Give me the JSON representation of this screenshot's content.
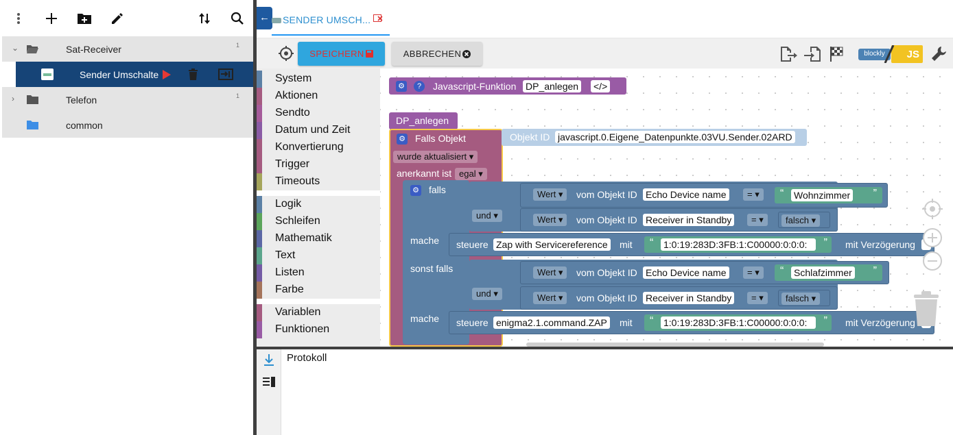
{
  "sidebar": {
    "toolbar": {
      "menu_icon": "more-vert-icon",
      "add_icon": "add-icon",
      "add_folder_icon": "create-folder-icon",
      "edit_icon": "edit-icon",
      "sort_icon": "sort-icon",
      "search_icon": "search-icon"
    },
    "tree": [
      {
        "label": "Sat-Receiver",
        "count": "1",
        "expanded": true
      },
      {
        "label": "Sender Umschalte",
        "selected": true
      },
      {
        "label": "Telefon",
        "count": "1",
        "expanded": false
      },
      {
        "label": "common"
      }
    ]
  },
  "tabs": [
    {
      "label": "SENDER UMSCH..."
    }
  ],
  "toolbar": {
    "save_label": "SPEICHERN",
    "cancel_label": "ABBRECHEN"
  },
  "categories": {
    "group1": [
      "System",
      "Aktionen",
      "Sendto",
      "Datum und Zeit",
      "Konvertierung",
      "Trigger",
      "Timeouts"
    ],
    "group2": [
      "Logik",
      "Schleifen",
      "Mathematik",
      "Text",
      "Listen",
      "Farbe"
    ],
    "group3": [
      "Variablen",
      "Funktionen"
    ]
  },
  "blocks": {
    "js_function": {
      "label": "Javascript-Funktion",
      "name": "DP_anlegen",
      "code": "</>"
    },
    "proc_call": {
      "label": "DP_anlegen"
    },
    "trigger": {
      "label": "Falls Objekt",
      "object_id_label": "Objekt ID",
      "object_id": "javascript.0.Eigene_Datenpunkte.03VU.Sender.02ARD",
      "updated": "wurde aktualisiert",
      "ack_label": "anerkannt ist",
      "ack_value": "egal"
    },
    "if_block": {
      "if_label": "falls",
      "else_if_label": "sonst falls",
      "do_label": "mache",
      "and_label": "und",
      "value_label": "Wert",
      "from_object": "vom Objekt ID",
      "cond1_obj": "Echo Device name",
      "cond1_op": "=",
      "cond1_val": "Wohnzimmer",
      "cond2_obj": "Receiver in Standby",
      "cond2_op": "=",
      "cond2_val": "falsch",
      "do1_control": "steuere",
      "do1_target": "Zap with Servicereference",
      "with_label": "mit",
      "do1_value": "1:0:19:283D:3FB:1:C00000:0:0:0:",
      "delay_label": "mit Verzögerung",
      "cond3_obj": "Echo Device name",
      "cond3_op": "=",
      "cond3_val": "Schlafzimmer",
      "cond4_obj": "Receiver in Standby",
      "cond4_op": "=",
      "cond4_val": "falsch",
      "do2_control": "steuere",
      "do2_target": "enigma2.1.command.ZAP",
      "do2_value": "1:0:19:283D:3FB:1:C00000:0:0:0:"
    }
  },
  "log": {
    "title": "Protokoll"
  },
  "colors": {
    "selected_row": "#164477",
    "save_button": "#2fa6de",
    "tab_accent": "#2196f3",
    "trigger_block": "#a55b80",
    "logic_block": "#5b80a5",
    "text_block": "#5ba58c",
    "function_block": "#995ba5"
  }
}
